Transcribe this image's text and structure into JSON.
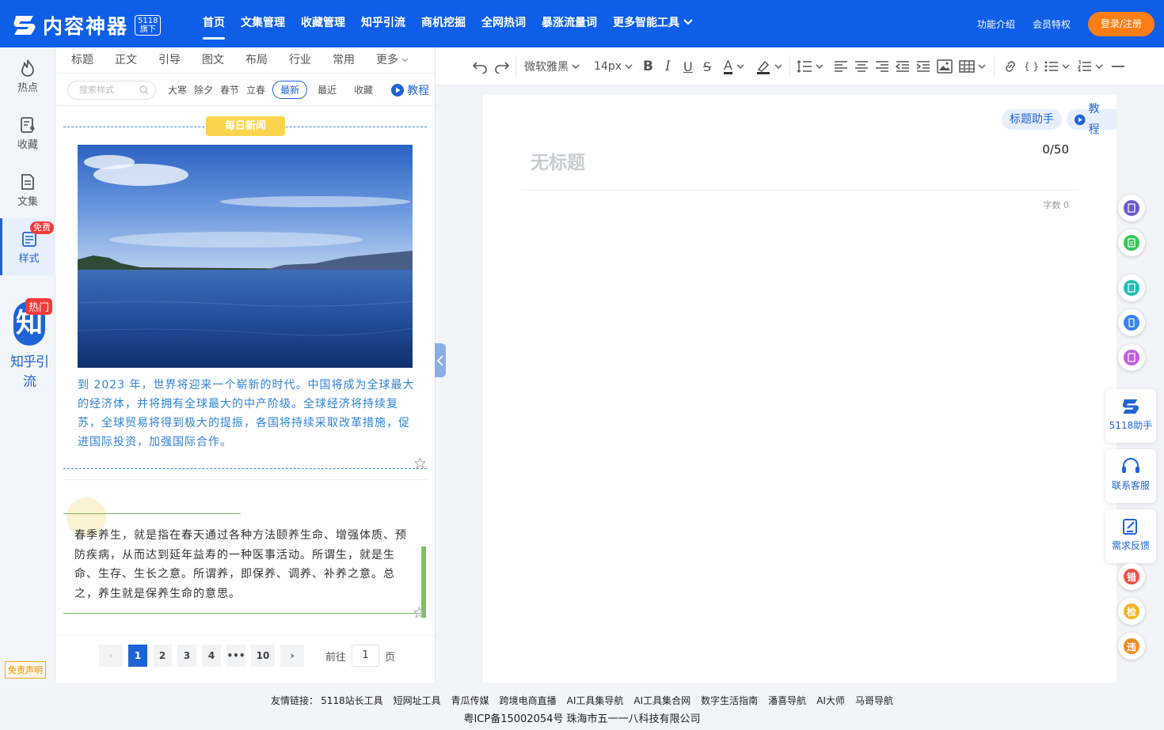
{
  "app": {
    "logo_text": "内容神器",
    "logo_badge_line1": "5118",
    "logo_badge_line2": "旗下"
  },
  "nav": {
    "items": [
      "首页",
      "文集管理",
      "收藏管理",
      "知乎引流",
      "商机挖掘",
      "全网热词",
      "暴涨流量词",
      "更多智能工具"
    ],
    "active": "首页",
    "feature_intro": "功能介绍",
    "membership": "会员特权",
    "login": "登录/注册"
  },
  "leftnav": {
    "items": [
      {
        "label": "热点",
        "icon": "fire-icon"
      },
      {
        "label": "收藏",
        "icon": "bookmark-icon"
      },
      {
        "label": "文集",
        "icon": "document-icon"
      },
      {
        "label": "样式",
        "icon": "style-icon"
      }
    ],
    "active": "样式",
    "free_badge": "免费",
    "zhihu_glyph": "知",
    "zhihu_hot": "热门",
    "zhihu_label": "知乎引流",
    "disclaimer": "免责声明"
  },
  "style_panel": {
    "categories": [
      "标题",
      "正文",
      "引导",
      "图文",
      "布局",
      "行业",
      "常用",
      "更多"
    ],
    "search_placeholder": "搜索样式",
    "tags": [
      "大寒",
      "除夕",
      "春节",
      "立春"
    ],
    "filters": [
      "最新",
      "最近",
      "收藏"
    ],
    "active_filter": "最新",
    "tutorial": "教程",
    "card1": {
      "tag": "每日新闻",
      "text": "到 2023 年，世界将迎来一个崭新的时代。中国将成为全球最大的经济体，并将拥有全球最大的中产阶级。全球经济将持续复苏，全球贸易将得到极大的提振，各国将持续采取改革措施，促进国际投资，加强国际合作。"
    },
    "card2": {
      "text": "春季养生，就是指在春天通过各种方法颐养生命、增强体质、预防疾病，从而达到延年益寿的一种医事活动。所谓生，就是生命、生存、生长之意。所谓养，即保养、调养、补养之意。总之，养生就是保养生命的意思。"
    },
    "pagination": {
      "pages": [
        "1",
        "2",
        "3",
        "4",
        "•••",
        "10"
      ],
      "current": "1",
      "goto_label": "前往",
      "goto_value": "1",
      "page_suffix": "页"
    }
  },
  "toolbar": {
    "font": "微软雅黑",
    "size": "14px",
    "bold": "B",
    "italic": "I",
    "underline": "U",
    "strike": "S",
    "font_color": "A"
  },
  "editor": {
    "title_helper": "标题助手",
    "tutorial": "教程",
    "title_placeholder": "无标题",
    "title_count": "0/50",
    "word_count": "字数 0"
  },
  "right_cards": [
    "5118助手",
    "联系客服",
    "需求反馈"
  ],
  "right_tools": {
    "error": "错",
    "check": "检",
    "violation": "违"
  },
  "footer": {
    "links_label": "友情链接：",
    "links": [
      "5118站长工具",
      "短网址工具",
      "青瓜传媒",
      "跨境电商直播",
      "AI工具集导航",
      "AI工具集合网",
      "数字生活指南",
      "潘喜导航",
      "AI大师",
      "马哥导航"
    ],
    "icp": "粤ICP备15002054号 珠海市五一一八科技有限公司"
  },
  "colors": {
    "brand_blue": "#0e5ee8",
    "login_orange": "#fd7e14",
    "news_text": "#2f82d4",
    "news_tag": "#f9d54d"
  }
}
